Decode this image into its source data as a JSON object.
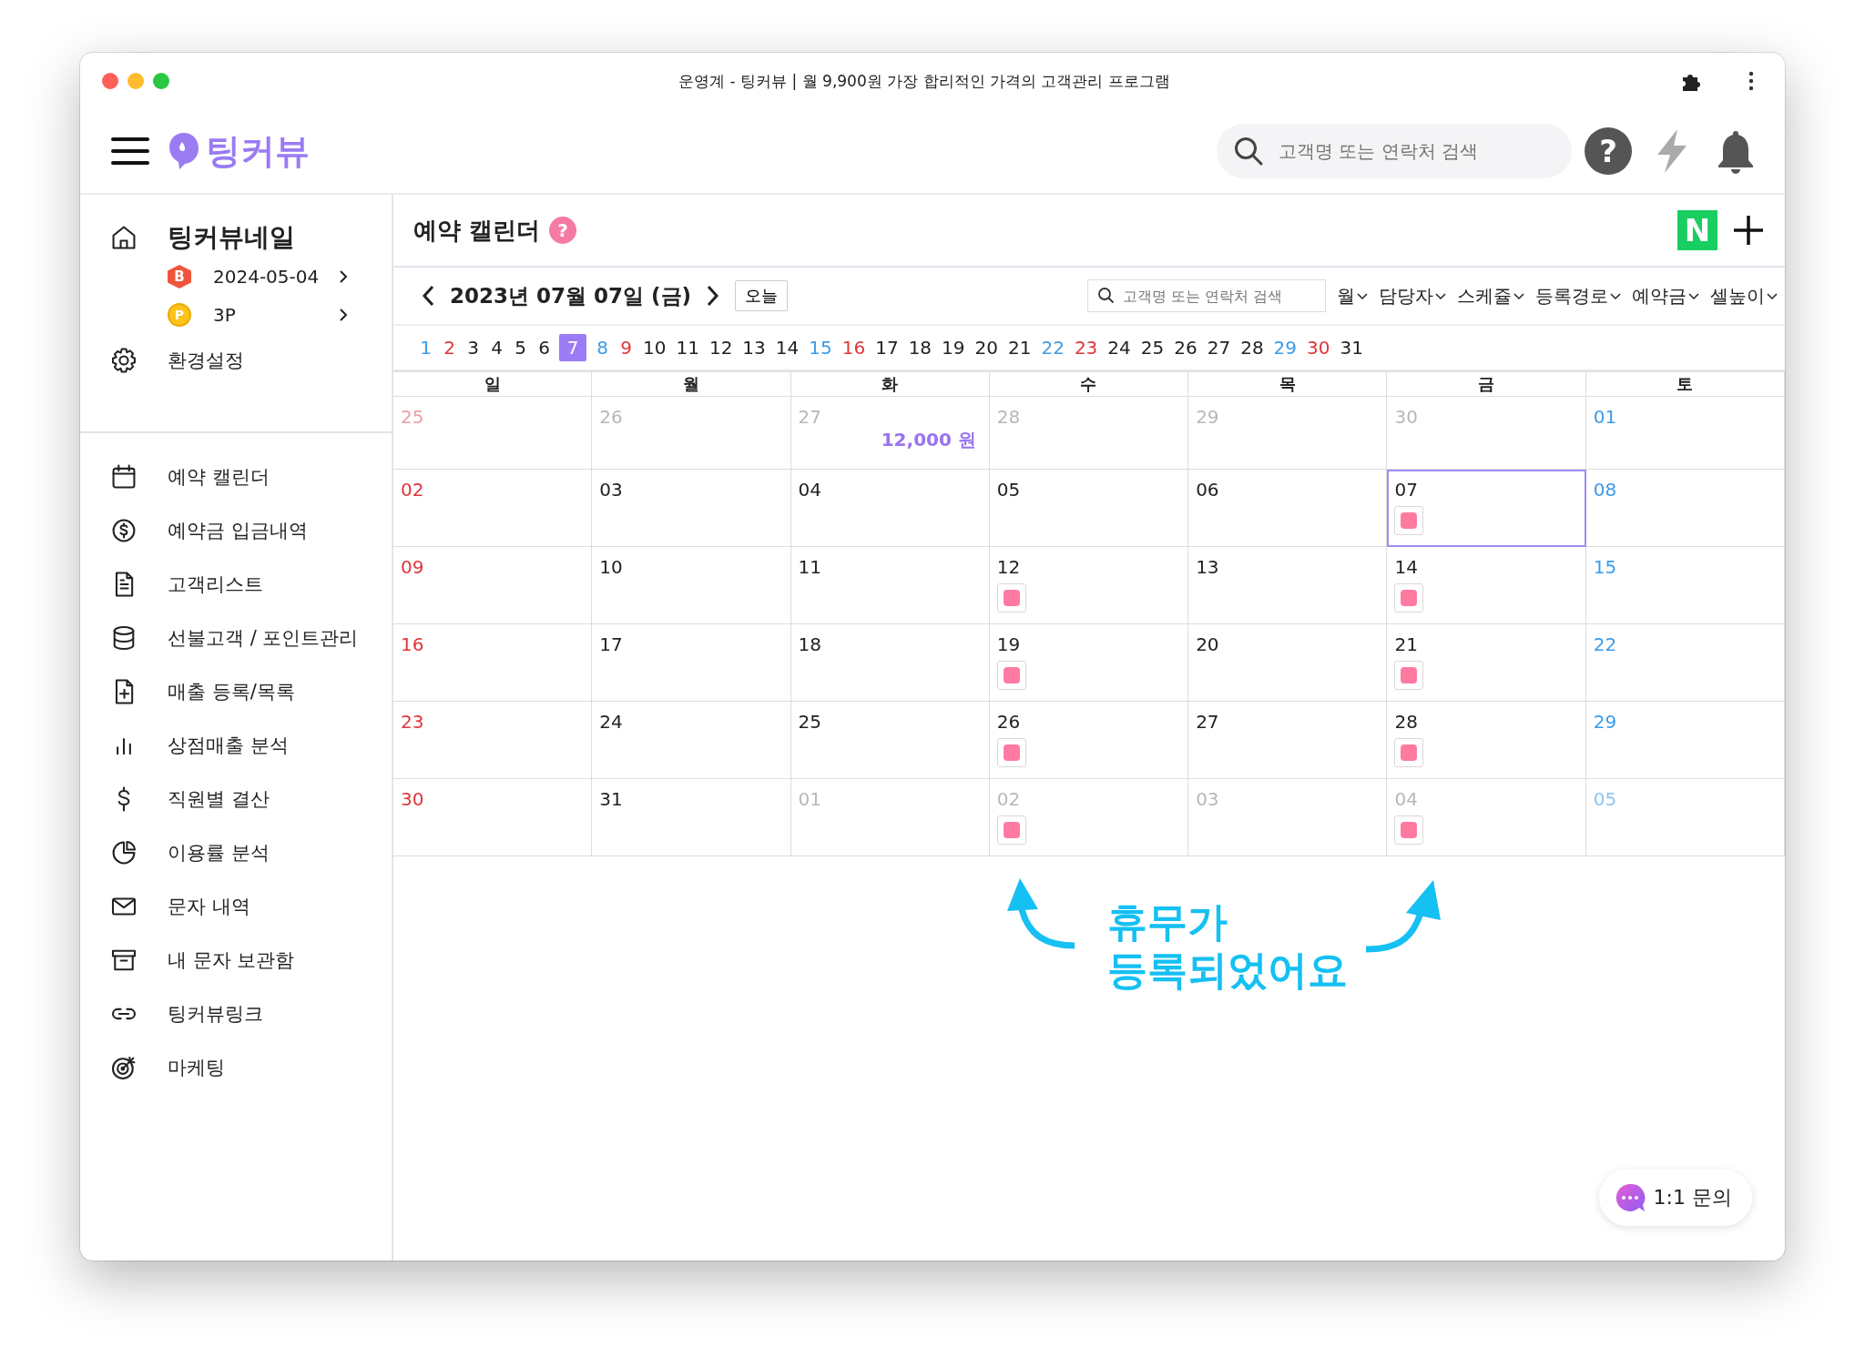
{
  "window": {
    "title": "운영계 - 팅커뷰 | 월 9,900원 가장 합리적인 가격의 고객관리 프로그램"
  },
  "header": {
    "logo": "팅커뷰",
    "search": {
      "placeholder": "고객명 또는 연락처 검색"
    },
    "help": "?"
  },
  "sidebar": {
    "account": {
      "name": "팅커뷰네일",
      "badge": "B",
      "plan_date": "2024-05-04",
      "coin": "P",
      "points": "3P"
    },
    "settings": "환경설정",
    "items": [
      {
        "label": "예약 캘린더"
      },
      {
        "label": "예약금 입금내역"
      },
      {
        "label": "고객리스트"
      },
      {
        "label": "선불고객 / 포인트관리"
      },
      {
        "label": "매출 등록/목록"
      },
      {
        "label": "상점매출 분석"
      },
      {
        "label": "직원별 결산"
      },
      {
        "label": "이용률 분석"
      },
      {
        "label": "문자 내역"
      },
      {
        "label": "내 문자 보관함"
      },
      {
        "label": "팅커뷰링크"
      },
      {
        "label": "마케팅"
      }
    ]
  },
  "page": {
    "title": "예약 캘린더",
    "help": "?",
    "naver": "N",
    "date": "2023년 07월 07일 (금)",
    "today": "오늘",
    "search": {
      "placeholder": "고객명 또는 연락처 검색"
    },
    "filters": [
      "월",
      "담당자",
      "스케쥴",
      "등록경로",
      "예약금",
      "셀높이"
    ]
  },
  "day_strip": [
    {
      "label": "1",
      "kind": "sat",
      "selected": false
    },
    {
      "label": "2",
      "kind": "sun",
      "selected": false
    },
    {
      "label": "3",
      "kind": "day",
      "selected": false
    },
    {
      "label": "4",
      "kind": "day",
      "selected": false
    },
    {
      "label": "5",
      "kind": "day",
      "selected": false
    },
    {
      "label": "6",
      "kind": "day",
      "selected": false
    },
    {
      "label": "7",
      "kind": "day",
      "selected": true
    },
    {
      "label": "8",
      "kind": "sat",
      "selected": false
    },
    {
      "label": "9",
      "kind": "sun",
      "selected": false
    },
    {
      "label": "10",
      "kind": "day",
      "selected": false
    },
    {
      "label": "11",
      "kind": "day",
      "selected": false
    },
    {
      "label": "12",
      "kind": "day",
      "selected": false
    },
    {
      "label": "13",
      "kind": "day",
      "selected": false
    },
    {
      "label": "14",
      "kind": "day",
      "selected": false
    },
    {
      "label": "15",
      "kind": "sat",
      "selected": false
    },
    {
      "label": "16",
      "kind": "sun",
      "selected": false
    },
    {
      "label": "17",
      "kind": "day",
      "selected": false
    },
    {
      "label": "18",
      "kind": "day",
      "selected": false
    },
    {
      "label": "19",
      "kind": "day",
      "selected": false
    },
    {
      "label": "20",
      "kind": "day",
      "selected": false
    },
    {
      "label": "21",
      "kind": "day",
      "selected": false
    },
    {
      "label": "22",
      "kind": "sat",
      "selected": false
    },
    {
      "label": "23",
      "kind": "sun",
      "selected": false
    },
    {
      "label": "24",
      "kind": "day",
      "selected": false
    },
    {
      "label": "25",
      "kind": "day",
      "selected": false
    },
    {
      "label": "26",
      "kind": "day",
      "selected": false
    },
    {
      "label": "27",
      "kind": "day",
      "selected": false
    },
    {
      "label": "28",
      "kind": "day",
      "selected": false
    },
    {
      "label": "29",
      "kind": "sat",
      "selected": false
    },
    {
      "label": "30",
      "kind": "sun",
      "selected": false
    },
    {
      "label": "31",
      "kind": "day",
      "selected": false
    }
  ],
  "calendar": {
    "weekdays": [
      "일",
      "월",
      "화",
      "수",
      "목",
      "금",
      "토"
    ],
    "weeks": [
      [
        {
          "label": "25",
          "kind": "sun",
          "outside": true,
          "holiday": false,
          "selected": false
        },
        {
          "label": "26",
          "kind": "day",
          "outside": true,
          "holiday": false,
          "selected": false
        },
        {
          "label": "27",
          "kind": "day",
          "outside": true,
          "holiday": false,
          "selected": false,
          "amount": "12,000 원"
        },
        {
          "label": "28",
          "kind": "day",
          "outside": true,
          "holiday": false,
          "selected": false
        },
        {
          "label": "29",
          "kind": "day",
          "outside": true,
          "holiday": false,
          "selected": false
        },
        {
          "label": "30",
          "kind": "day",
          "outside": true,
          "holiday": false,
          "selected": false
        },
        {
          "label": "01",
          "kind": "sat",
          "outside": false,
          "holiday": false,
          "selected": false
        }
      ],
      [
        {
          "label": "02",
          "kind": "sun",
          "outside": false,
          "holiday": false,
          "selected": false
        },
        {
          "label": "03",
          "kind": "day",
          "outside": false,
          "holiday": false,
          "selected": false
        },
        {
          "label": "04",
          "kind": "day",
          "outside": false,
          "holiday": false,
          "selected": false
        },
        {
          "label": "05",
          "kind": "day",
          "outside": false,
          "holiday": false,
          "selected": false
        },
        {
          "label": "06",
          "kind": "day",
          "outside": false,
          "holiday": false,
          "selected": false
        },
        {
          "label": "07",
          "kind": "day",
          "outside": false,
          "holiday": true,
          "selected": true
        },
        {
          "label": "08",
          "kind": "sat",
          "outside": false,
          "holiday": false,
          "selected": false
        }
      ],
      [
        {
          "label": "09",
          "kind": "sun",
          "outside": false,
          "holiday": false,
          "selected": false
        },
        {
          "label": "10",
          "kind": "day",
          "outside": false,
          "holiday": false,
          "selected": false
        },
        {
          "label": "11",
          "kind": "day",
          "outside": false,
          "holiday": false,
          "selected": false
        },
        {
          "label": "12",
          "kind": "day",
          "outside": false,
          "holiday": true,
          "selected": false
        },
        {
          "label": "13",
          "kind": "day",
          "outside": false,
          "holiday": false,
          "selected": false
        },
        {
          "label": "14",
          "kind": "day",
          "outside": false,
          "holiday": true,
          "selected": false
        },
        {
          "label": "15",
          "kind": "sat",
          "outside": false,
          "holiday": false,
          "selected": false
        }
      ],
      [
        {
          "label": "16",
          "kind": "sun",
          "outside": false,
          "holiday": false,
          "selected": false
        },
        {
          "label": "17",
          "kind": "day",
          "outside": false,
          "holiday": false,
          "selected": false
        },
        {
          "label": "18",
          "kind": "day",
          "outside": false,
          "holiday": false,
          "selected": false
        },
        {
          "label": "19",
          "kind": "day",
          "outside": false,
          "holiday": true,
          "selected": false
        },
        {
          "label": "20",
          "kind": "day",
          "outside": false,
          "holiday": false,
          "selected": false
        },
        {
          "label": "21",
          "kind": "day",
          "outside": false,
          "holiday": true,
          "selected": false
        },
        {
          "label": "22",
          "kind": "sat",
          "outside": false,
          "holiday": false,
          "selected": false
        }
      ],
      [
        {
          "label": "23",
          "kind": "sun",
          "outside": false,
          "holiday": false,
          "selected": false
        },
        {
          "label": "24",
          "kind": "day",
          "outside": false,
          "holiday": false,
          "selected": false
        },
        {
          "label": "25",
          "kind": "day",
          "outside": false,
          "holiday": false,
          "selected": false
        },
        {
          "label": "26",
          "kind": "day",
          "outside": false,
          "holiday": true,
          "selected": false
        },
        {
          "label": "27",
          "kind": "day",
          "outside": false,
          "holiday": false,
          "selected": false
        },
        {
          "label": "28",
          "kind": "day",
          "outside": false,
          "holiday": true,
          "selected": false
        },
        {
          "label": "29",
          "kind": "sat",
          "outside": false,
          "holiday": false,
          "selected": false
        }
      ],
      [
        {
          "label": "30",
          "kind": "sun",
          "outside": false,
          "holiday": false,
          "selected": false
        },
        {
          "label": "31",
          "kind": "day",
          "outside": false,
          "holiday": false,
          "selected": false
        },
        {
          "label": "01",
          "kind": "day",
          "outside": true,
          "holiday": false,
          "selected": false
        },
        {
          "label": "02",
          "kind": "day",
          "outside": true,
          "holiday": true,
          "selected": false
        },
        {
          "label": "03",
          "kind": "day",
          "outside": true,
          "holiday": false,
          "selected": false
        },
        {
          "label": "04",
          "kind": "day",
          "outside": true,
          "holiday": true,
          "selected": false
        },
        {
          "label": "05",
          "kind": "sat",
          "outside": true,
          "holiday": false,
          "selected": false
        }
      ]
    ]
  },
  "annotation": {
    "lines": [
      "휴무가",
      "등록되었어요"
    ]
  },
  "chat": {
    "label": "1:1 문의"
  }
}
